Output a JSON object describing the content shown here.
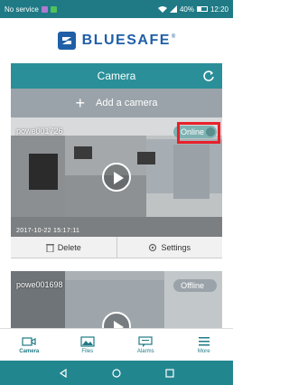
{
  "status_bar": {
    "carrier": "No service",
    "battery": "40%",
    "time": "12:20"
  },
  "brand": {
    "name": "BLUESAFE",
    "mark": "®"
  },
  "header": {
    "title": "Camera"
  },
  "add_camera": {
    "label": "Add a camera"
  },
  "cameras": [
    {
      "name": "powe001726",
      "status": "Online",
      "timestamp": "2017-10-22 15:17:11",
      "delete_label": "Delete",
      "settings_label": "Settings"
    },
    {
      "name": "powe001698",
      "status": "Offline"
    }
  ],
  "tabs": [
    {
      "label": "Camera",
      "icon": "camera-icon"
    },
    {
      "label": "Files",
      "icon": "image-icon"
    },
    {
      "label": "Alarms",
      "icon": "message-icon"
    },
    {
      "label": "More",
      "icon": "menu-icon"
    }
  ],
  "colors": {
    "accent": "#1f7a85",
    "header": "#2a8f98",
    "brand": "#1f5fa7",
    "highlight": "#e8202a"
  }
}
